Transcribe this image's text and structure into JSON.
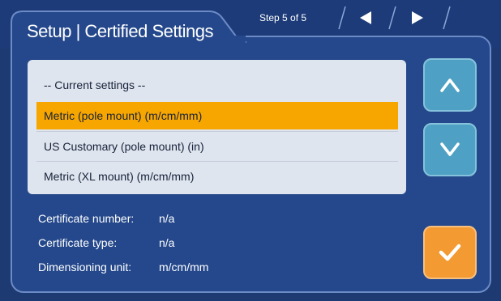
{
  "header": {
    "title": "Setup | Certified Settings",
    "step": "Step 5 of 5",
    "prev_icon": "triangle-left-icon",
    "next_icon": "triangle-right-icon"
  },
  "list": {
    "items": [
      {
        "label": "-- Current settings --",
        "selected": false
      },
      {
        "label": "Metric (pole mount) (m/cm/mm)",
        "selected": true
      },
      {
        "label": "US Customary (pole mount) (in)",
        "selected": false
      },
      {
        "label": "Metric (XL mount) (m/cm/mm)",
        "selected": false
      }
    ]
  },
  "info": [
    {
      "label": "Certificate number:",
      "value": "n/a"
    },
    {
      "label": "Certificate type:",
      "value": "n/a"
    },
    {
      "label": "Dimensioning unit:",
      "value": "m/cm/mm"
    }
  ],
  "buttons": {
    "up_icon": "chevron-up-icon",
    "down_icon": "chevron-down-icon",
    "confirm_icon": "checkmark-icon"
  },
  "colors": {
    "background": "#1e3a72",
    "panel": "#24488b",
    "panel_border": "#6c8bc6",
    "list_bg": "#dfe5ee",
    "selected": "#f7a600",
    "scroll_button": "#4ea0c4",
    "confirm_button": "#f39a33"
  }
}
